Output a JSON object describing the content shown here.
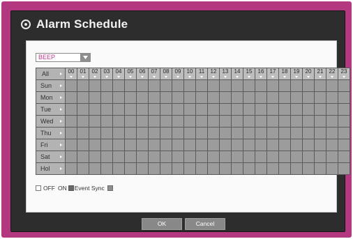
{
  "window": {
    "title": "Alarm Schedule"
  },
  "dropdown": {
    "value": "BEEP"
  },
  "grid": {
    "all_label": "All",
    "hours": [
      "00",
      "01",
      "02",
      "03",
      "04",
      "05",
      "06",
      "07",
      "08",
      "09",
      "10",
      "11",
      "12",
      "13",
      "14",
      "15",
      "16",
      "17",
      "18",
      "19",
      "20",
      "21",
      "22",
      "23"
    ],
    "days": [
      "Sun",
      "Mon",
      "Tue",
      "Wed",
      "Thu",
      "Fri",
      "Sat",
      "Hol"
    ]
  },
  "legend": {
    "off_label": "OFF",
    "on_label": "ON",
    "event_sync_label": "Event Sync"
  },
  "buttons": {
    "ok_label": "OK",
    "cancel_label": "Cancel"
  },
  "colors": {
    "frame": "#b4387f",
    "panel": "#2d2d2d",
    "cell_on": "#9c9c9c",
    "dropdown_text": "#b8388a"
  }
}
